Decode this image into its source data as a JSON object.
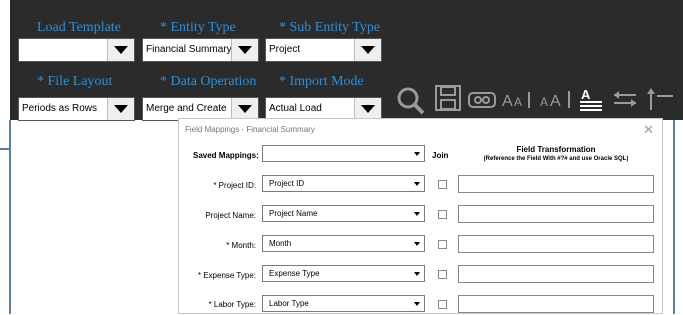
{
  "toolbar": {
    "load_template": {
      "label": "Load Template",
      "value": ""
    },
    "entity_type": {
      "label": "* Entity Type",
      "value": "Financial Summary"
    },
    "sub_entity_type": {
      "label": "* Sub Entity Type",
      "value": "Project"
    },
    "file_layout": {
      "label": "* File Layout",
      "value": "Periods as Rows"
    },
    "data_operation": {
      "label": "* Data Operation",
      "value": "Merge and Create"
    },
    "import_mode": {
      "label": "* Import Mode",
      "value": "Actual Load"
    },
    "icons": [
      "search-icon",
      "save-icon",
      "preview-icon",
      "font-size-decrease-icon",
      "font-size-increase-icon",
      "text-align-icon",
      "arrows-icon",
      "arrow-up-icon"
    ]
  },
  "dialog": {
    "title": "Field Mappings - Financial Summary",
    "saved_mappings_label": "Saved Mappings:",
    "saved_mappings_value": "",
    "join_label": "Join",
    "field_transformation_title": "Field Transformation",
    "field_transformation_subtitle": "(Reference the Field With #?# and use Oracle SQL)",
    "rows": [
      {
        "label": "* Project ID:",
        "value": "Project ID",
        "join": false,
        "transformation": ""
      },
      {
        "label": "Project Name:",
        "value": "Project Name",
        "join": false,
        "transformation": ""
      },
      {
        "label": "* Month:",
        "value": "Month",
        "join": false,
        "transformation": ""
      },
      {
        "label": "* Expense Type:",
        "value": "Expense Type",
        "join": false,
        "transformation": ""
      },
      {
        "label": "* Labor Type:",
        "value": "Labor Type",
        "join": false,
        "transformation": ""
      }
    ]
  },
  "colors": {
    "toolbar_bg": "#2b2b2b",
    "label_blue": "#2f8fd6",
    "border_blue": "#5b7fa6"
  }
}
